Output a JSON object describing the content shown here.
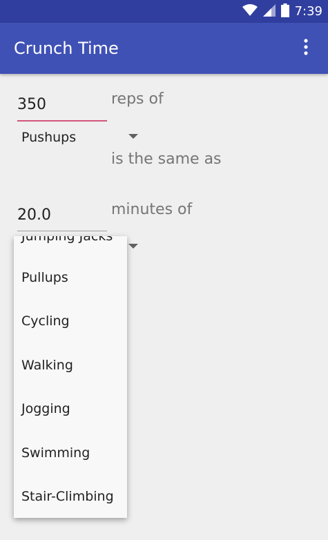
{
  "status_bar": {
    "time": "7:39",
    "icons": [
      "wifi-icon",
      "signal-icon",
      "battery-icon"
    ]
  },
  "app_bar": {
    "title": "Crunch Time",
    "menu_icon": "more-vert-icon"
  },
  "converter": {
    "reps_value": "350",
    "reps_label": "reps of",
    "exercise_selected": "Pushups",
    "same_as_label": "is the same as",
    "minutes_value": "20.0",
    "minutes_label": "minutes of"
  },
  "dropdown": {
    "partial_item": "Jumping Jacks",
    "items": [
      "Pullups",
      "Cycling",
      "Walking",
      "Jogging",
      "Swimming",
      "Stair-Climbing"
    ]
  },
  "colors": {
    "status_bar": "#303f9f",
    "app_bar": "#3f51b5",
    "accent": "#d1557b",
    "background": "#efefef"
  }
}
